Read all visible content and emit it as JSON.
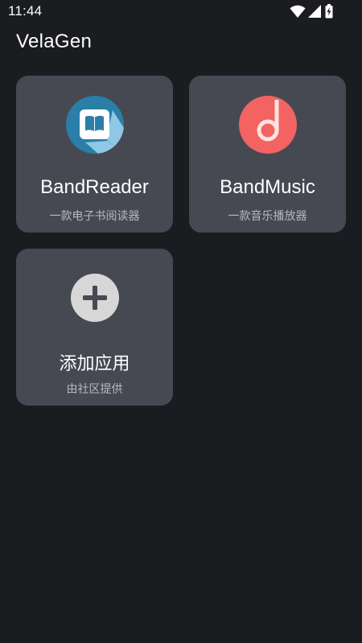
{
  "status_bar": {
    "time": "11:44",
    "icons": [
      "wifi-icon",
      "signal-icon",
      "battery-charging-icon"
    ]
  },
  "app": {
    "title": "VelaGen"
  },
  "cards": [
    {
      "title": "BandReader",
      "subtitle": "一款电子书阅读器",
      "icon": "book-icon",
      "icon_color": "#2a7ea8"
    },
    {
      "title": "BandMusic",
      "subtitle": "一款音乐播放器",
      "icon": "music-note-icon",
      "icon_color": "#f26361"
    },
    {
      "title": "添加应用",
      "subtitle": "由社区提供",
      "icon": "plus-icon",
      "icon_color": "#d7d7d7"
    }
  ],
  "colors": {
    "background": "#1a1c1f",
    "card": "#464952",
    "subtitle_text": "#b6b9bf"
  }
}
